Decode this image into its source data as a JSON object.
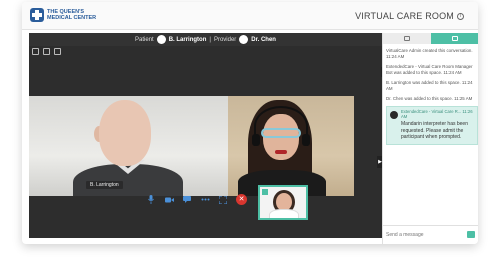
{
  "header": {
    "logo_line1": "THE QUEEN'S",
    "logo_line2": "MEDICAL CENTER",
    "room_title": "VIRTUAL CARE ROOM",
    "info_icon": "info-icon"
  },
  "video": {
    "patient_label": "Patient",
    "patient_name": "B. Larrington",
    "provider_label": "Provider",
    "provider_name": "Dr. Chen",
    "separator": "|",
    "tile_name_tag": "B. Larrington",
    "end_icon": "✕"
  },
  "chat": {
    "messages": [
      "VirtualCare Admin created this conversation. 11:24 AM",
      "ExtendedCare - Virtual Care Room Manager Bot was added to this space. 11:24 AM",
      "B. Larrington was added to this space. 11:24 AM",
      "Dr. Chen was added to this space. 11:25 AM"
    ],
    "bubble_header": "ExtendedCare - Virtual Care R... 11:26 AM",
    "bubble_text": "Mandarin interpreter has been requested. Please admit the participant when prompted.",
    "input_placeholder": "Send a message"
  },
  "colors": {
    "accent": "#4dbfa5",
    "brand": "#2b5d9b",
    "end_call": "#d9362f"
  }
}
